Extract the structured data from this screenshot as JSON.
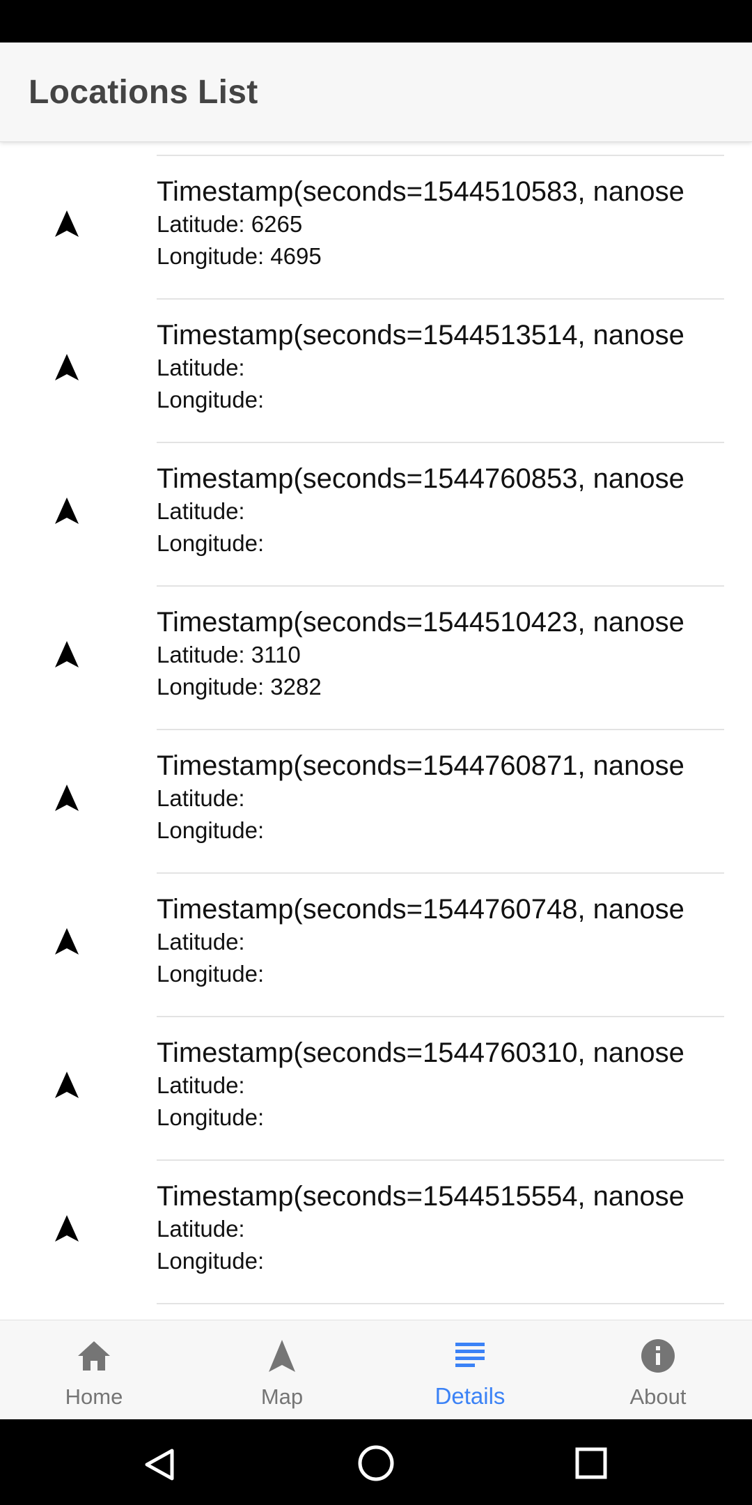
{
  "app_bar": {
    "title": "Locations List"
  },
  "rows": [
    {
      "timestamp": "Timestamp(seconds=1544510583, nanose",
      "latitude": "Latitude: 6265",
      "longitude": "Longitude: 4695"
    },
    {
      "timestamp": "Timestamp(seconds=1544513514, nanose",
      "latitude": "Latitude:",
      "longitude": "Longitude:"
    },
    {
      "timestamp": "Timestamp(seconds=1544760853, nanose",
      "latitude": "Latitude:",
      "longitude": "Longitude:"
    },
    {
      "timestamp": "Timestamp(seconds=1544510423, nanose",
      "latitude": "Latitude: 3110",
      "longitude": "Longitude: 3282"
    },
    {
      "timestamp": "Timestamp(seconds=1544760871, nanose",
      "latitude": "Latitude:",
      "longitude": "Longitude:"
    },
    {
      "timestamp": "Timestamp(seconds=1544760748, nanose",
      "latitude": "Latitude:",
      "longitude": "Longitude:"
    },
    {
      "timestamp": "Timestamp(seconds=1544760310, nanose",
      "latitude": "Latitude:",
      "longitude": "Longitude:"
    },
    {
      "timestamp": "Timestamp(seconds=1544515554, nanose",
      "latitude": "Latitude:",
      "longitude": "Longitude:"
    }
  ],
  "row_icon": "navigation-arrow-icon",
  "bottom_nav": {
    "items": [
      {
        "label": "Home",
        "icon": "home-icon",
        "active": false
      },
      {
        "label": "Map",
        "icon": "navigation-arrow-icon",
        "active": false
      },
      {
        "label": "Details",
        "icon": "list-icon",
        "active": true
      },
      {
        "label": "About",
        "icon": "info-icon",
        "active": false
      }
    ],
    "active_color": "#3b82f6",
    "inactive_color": "#757575"
  },
  "system_nav": {
    "buttons": [
      "back-icon",
      "home-circle-icon",
      "recents-square-icon"
    ]
  }
}
